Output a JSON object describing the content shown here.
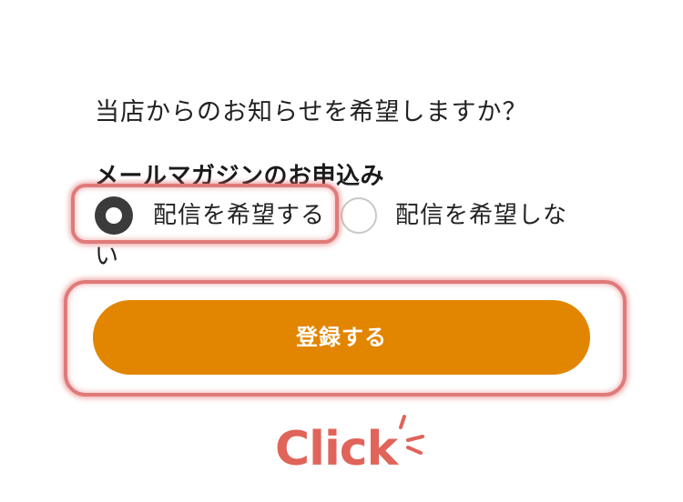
{
  "form": {
    "question": "当店からのお知らせを希望しますか？",
    "section_title": "メールマガジンのお申込み",
    "options": [
      {
        "label": "配信を希望する",
        "selected": true
      },
      {
        "label": "配信を希望しな",
        "label_wrap": "い",
        "selected": false
      }
    ],
    "submit_label": "登録する"
  },
  "annotation": {
    "click_label": "Click",
    "click_icon": "click-burst-icon"
  },
  "colors": {
    "button": "#e28500",
    "highlight": "#e07a7a",
    "annotation": "#e0645a",
    "radio_checked": "#3b3b3b"
  }
}
